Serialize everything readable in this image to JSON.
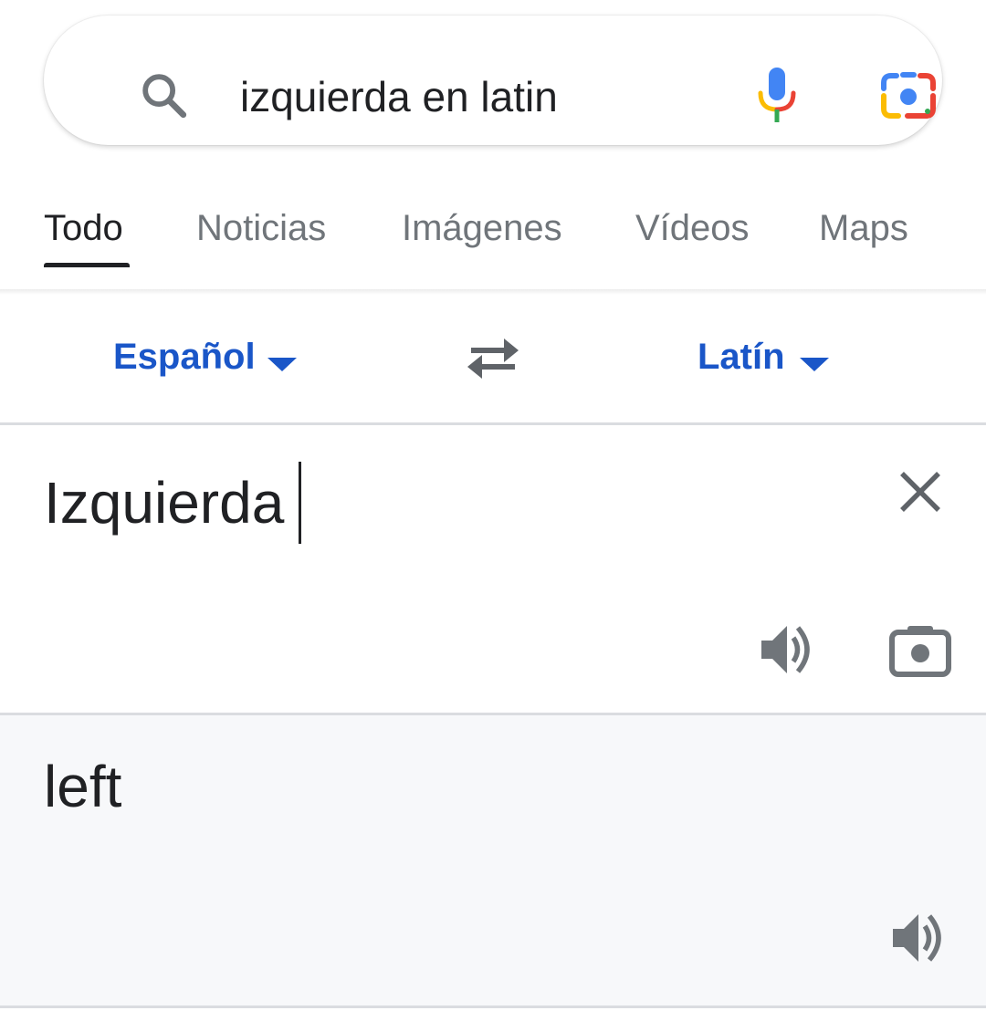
{
  "search": {
    "query": "izquierda en latin"
  },
  "icons": {
    "search": "search-icon",
    "mic": "mic-icon",
    "lens": "lens-icon",
    "swap": "swap-arrows-icon",
    "clear": "close-icon",
    "speaker": "speaker-icon",
    "camera": "camera-icon"
  },
  "tabs": [
    {
      "label": "Todo",
      "active": true
    },
    {
      "label": "Noticias",
      "active": false
    },
    {
      "label": "Imágenes",
      "active": false
    },
    {
      "label": "Vídeos",
      "active": false
    },
    {
      "label": "Maps",
      "active": false
    }
  ],
  "translator": {
    "source_language": "Español",
    "target_language": "Latín",
    "source_text": "Izquierda",
    "translated_text": "left"
  },
  "colors": {
    "accent_blue": "#1a56c8",
    "text_primary": "#202124",
    "text_secondary": "#70757a",
    "icon_gray": "#70757a",
    "result_background": "#f7f8fa"
  }
}
